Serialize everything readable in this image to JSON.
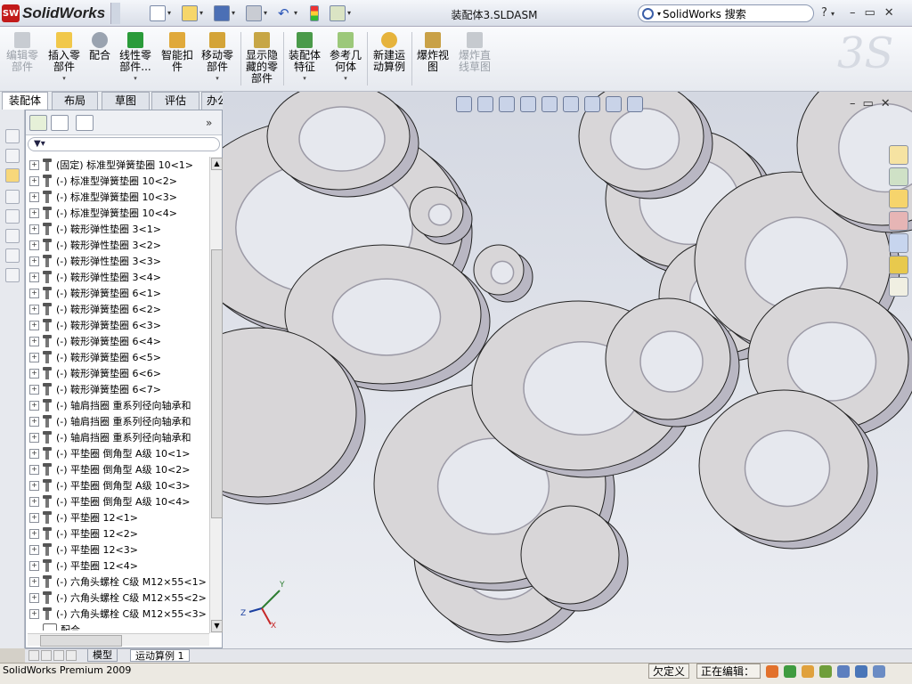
{
  "app": {
    "logo_text": "SolidWorks",
    "logo_badge": "SW",
    "document_title": "装配体3.SLDASM"
  },
  "search": {
    "placeholder": "SolidWorks 搜索"
  },
  "help_label": "?",
  "window_controls": [
    "–",
    "▭",
    "✕"
  ],
  "command_manager": [
    {
      "label": "编辑零\n部件",
      "enabled": false
    },
    {
      "label": "插入零\n部件",
      "enabled": true
    },
    {
      "label": "配合",
      "enabled": true
    },
    {
      "label": "线性零\n部件...",
      "enabled": true
    },
    {
      "label": "智能扣\n件",
      "enabled": true
    },
    {
      "label": "移动零\n部件",
      "enabled": true
    },
    {
      "label": "显示隐\n藏的零\n部件",
      "enabled": true
    },
    {
      "label": "装配体\n特征",
      "enabled": true
    },
    {
      "label": "参考几\n何体",
      "enabled": true
    },
    {
      "label": "新建运\n动算例",
      "enabled": true
    },
    {
      "label": "爆炸视\n图",
      "enabled": true
    },
    {
      "label": "爆炸直\n线草图",
      "enabled": false
    }
  ],
  "tabs": [
    "装配体",
    "布局",
    "草图",
    "评估",
    "办公室产品"
  ],
  "active_tab": "装配体",
  "feature_tree": [
    "(固定) 标准型弹簧垫圈 10<1>",
    "(-) 标准型弹簧垫圈 10<2>",
    "(-) 标准型弹簧垫圈 10<3>",
    "(-) 标准型弹簧垫圈 10<4>",
    "(-) 鞍形弹性垫圈 3<1>",
    "(-) 鞍形弹性垫圈 3<2>",
    "(-) 鞍形弹性垫圈 3<3>",
    "(-) 鞍形弹性垫圈 3<4>",
    "(-) 鞍形弹簧垫圈 6<1>",
    "(-) 鞍形弹簧垫圈 6<2>",
    "(-) 鞍形弹簧垫圈 6<3>",
    "(-) 鞍形弹簧垫圈 6<4>",
    "(-) 鞍形弹簧垫圈 6<5>",
    "(-) 鞍形弹簧垫圈 6<6>",
    "(-) 鞍形弹簧垫圈 6<7>",
    "(-) 轴肩挡圈 重系列径向轴承和",
    "(-) 轴肩挡圈 重系列径向轴承和",
    "(-) 轴肩挡圈 重系列径向轴承和",
    "(-) 平垫圈 倒角型 A级 10<1>",
    "(-) 平垫圈 倒角型 A级 10<2>",
    "(-) 平垫圈 倒角型 A级 10<3>",
    "(-) 平垫圈 倒角型 A级 10<4>",
    "(-) 平垫圈 12<1>",
    "(-) 平垫圈 12<2>",
    "(-) 平垫圈 12<3>",
    "(-) 平垫圈 12<4>",
    "(-) 六角头螺栓 C级 M12×55<1>",
    "(-) 六角头螺栓 C级 M12×55<2>",
    "(-) 六角头螺栓 C级 M12×55<3>"
  ],
  "mates_label": "配合",
  "bottom_tabs": [
    "模型",
    "运动算例 1"
  ],
  "active_bottom_tab": "运动算例 1",
  "triad": {
    "x": "X",
    "y": "Y",
    "z": "Z"
  },
  "status": {
    "text": "SolidWorks Premium 2009",
    "underdefined": "欠定义",
    "editing": "正在编辑："
  },
  "colors": {
    "accent": "#c21a1a",
    "washer_face": "#d8d6d8",
    "washer_edge": "#9c9aa6",
    "viewport": "#e3e6ed"
  }
}
